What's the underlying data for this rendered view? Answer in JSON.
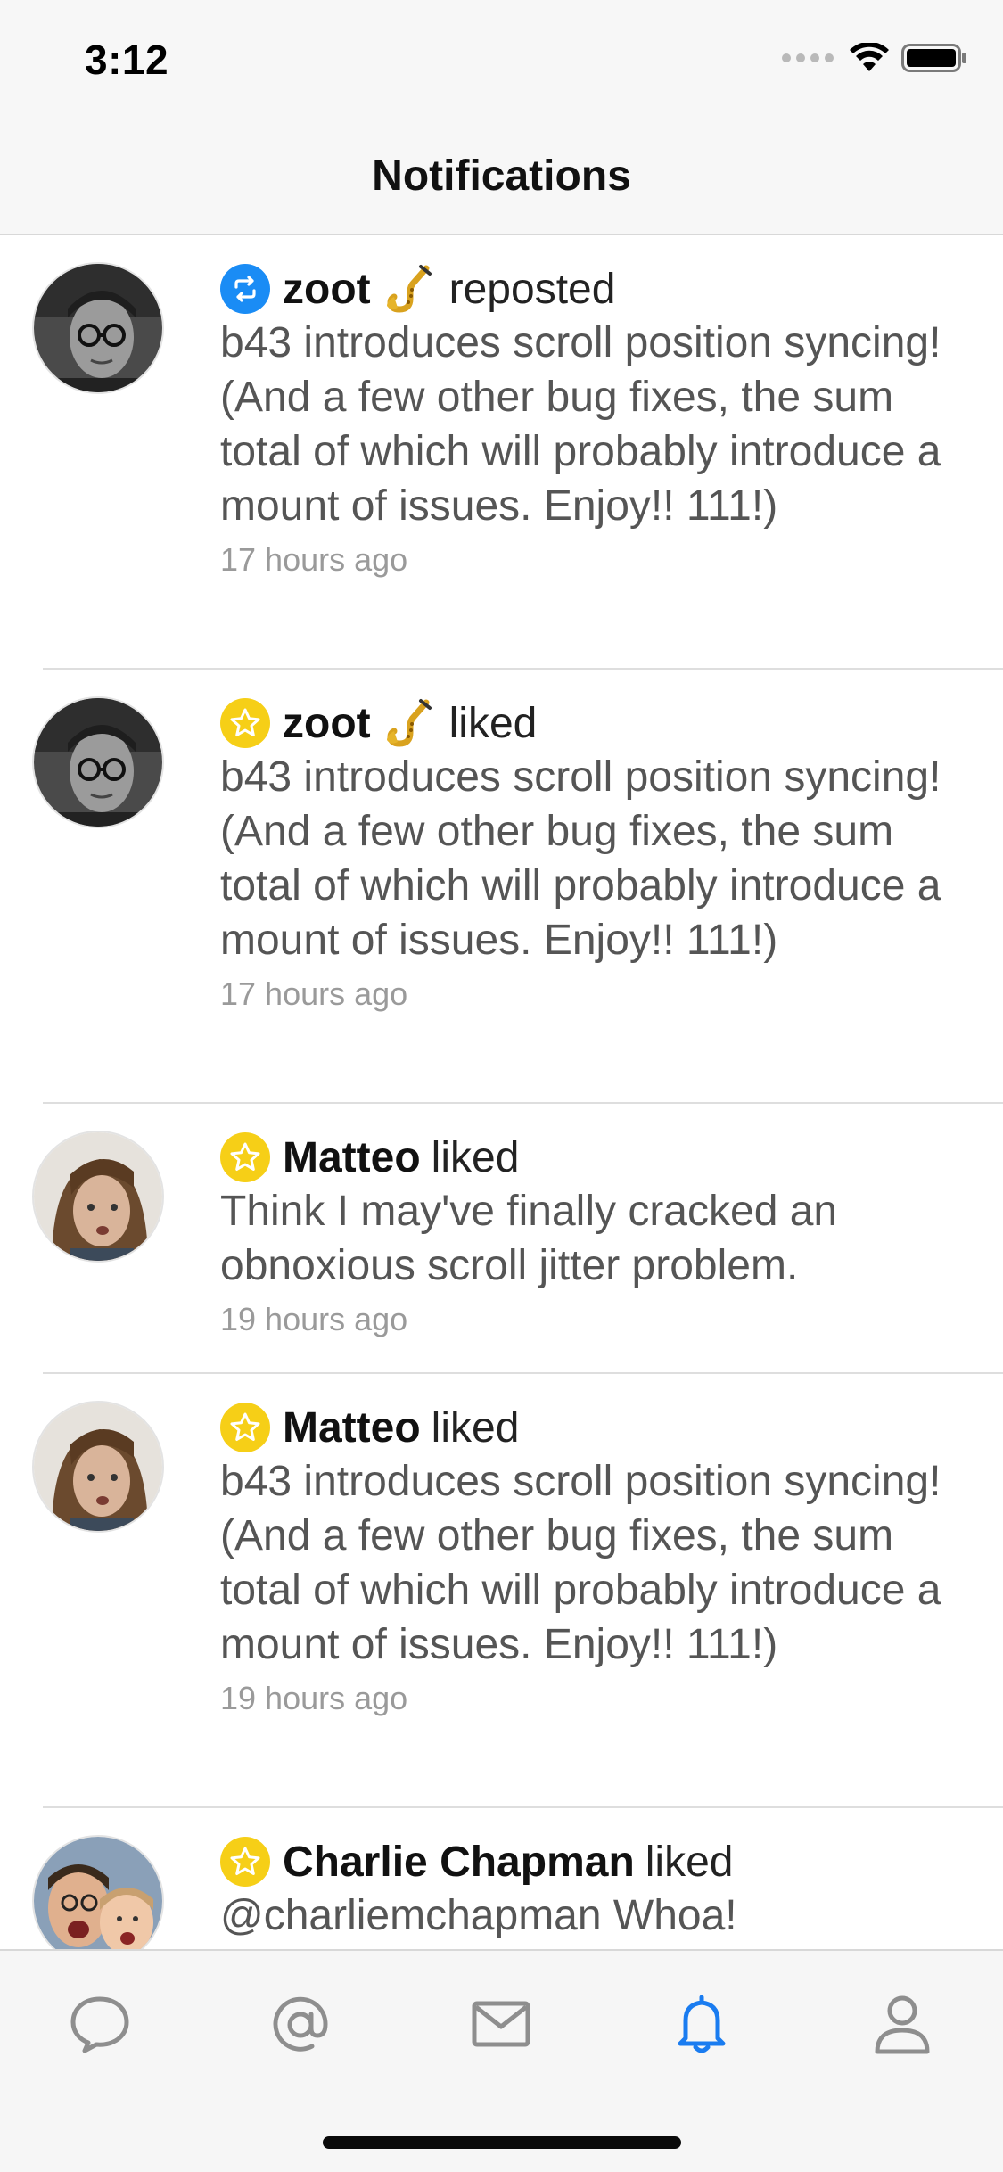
{
  "status_bar": {
    "time": "3:12"
  },
  "nav": {
    "title": "Notifications"
  },
  "notifications": [
    {
      "type": "repost",
      "badge_icon": "repost-icon",
      "name": "zoot",
      "emoji": "saxophone",
      "action": "reposted",
      "body": "b43 introduces scroll position syncing! (And a few other bug fixes, the sum total of which will probably introduce a mount of issues. Enjoy!! 111!)",
      "time": "17 hours ago"
    },
    {
      "type": "like",
      "badge_icon": "star-icon",
      "name": "zoot",
      "emoji": "saxophone",
      "action": "liked",
      "body": "b43 introduces scroll position syncing! (And a few other bug fixes, the sum total of which will probably introduce a mount of issues. Enjoy!! 111!)",
      "time": "17 hours ago"
    },
    {
      "type": "like",
      "badge_icon": "star-icon",
      "name": "Matteo",
      "action": "liked",
      "body": "Think I may've finally cracked an obnoxious scroll jitter problem.",
      "time": "19 hours ago"
    },
    {
      "type": "like",
      "badge_icon": "star-icon",
      "name": "Matteo",
      "action": "liked",
      "body": "b43 introduces scroll position syncing! (And a few other bug fixes, the sum total of which will probably introduce a mount of issues. Enjoy!! 111!)",
      "time": "19 hours ago"
    },
    {
      "type": "like",
      "badge_icon": "star-icon",
      "name": "Charlie Chapman",
      "action": "liked",
      "body": "@charliemchapman Whoa!",
      "time": ""
    }
  ],
  "tab_bar": {
    "items": [
      {
        "icon": "chat-bubble-icon",
        "active": false
      },
      {
        "icon": "at-sign-icon",
        "active": false
      },
      {
        "icon": "envelope-icon",
        "active": false
      },
      {
        "icon": "bell-icon",
        "active": true
      },
      {
        "icon": "person-icon",
        "active": false
      }
    ],
    "active_color": "#1a7cf0",
    "inactive_color": "#8e8e8e"
  },
  "colors": {
    "repost_badge": "#1a8cf5",
    "like_badge": "#f6cf17"
  }
}
